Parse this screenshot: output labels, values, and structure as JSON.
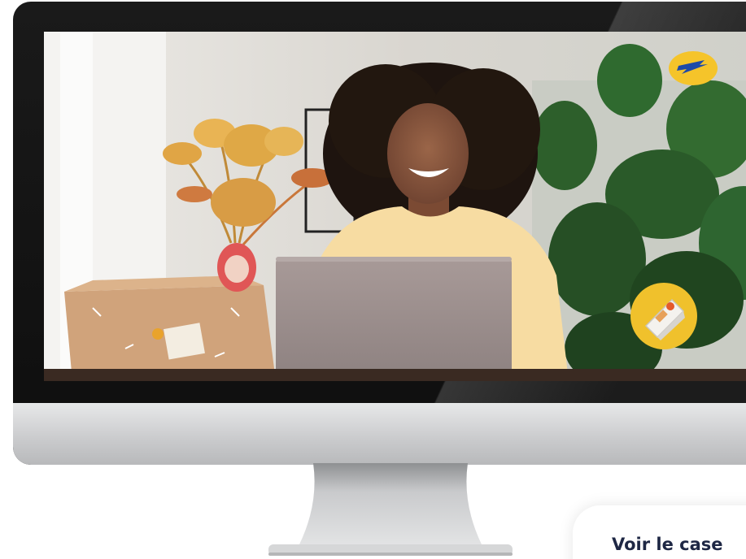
{
  "cta": {
    "label": "Voir le case"
  },
  "brand": {
    "logo": "la-poste-logo",
    "accent": "#f5c42a",
    "blue": "#1e4aa8"
  },
  "icons": {
    "badge": "laptop-badge-icon"
  }
}
